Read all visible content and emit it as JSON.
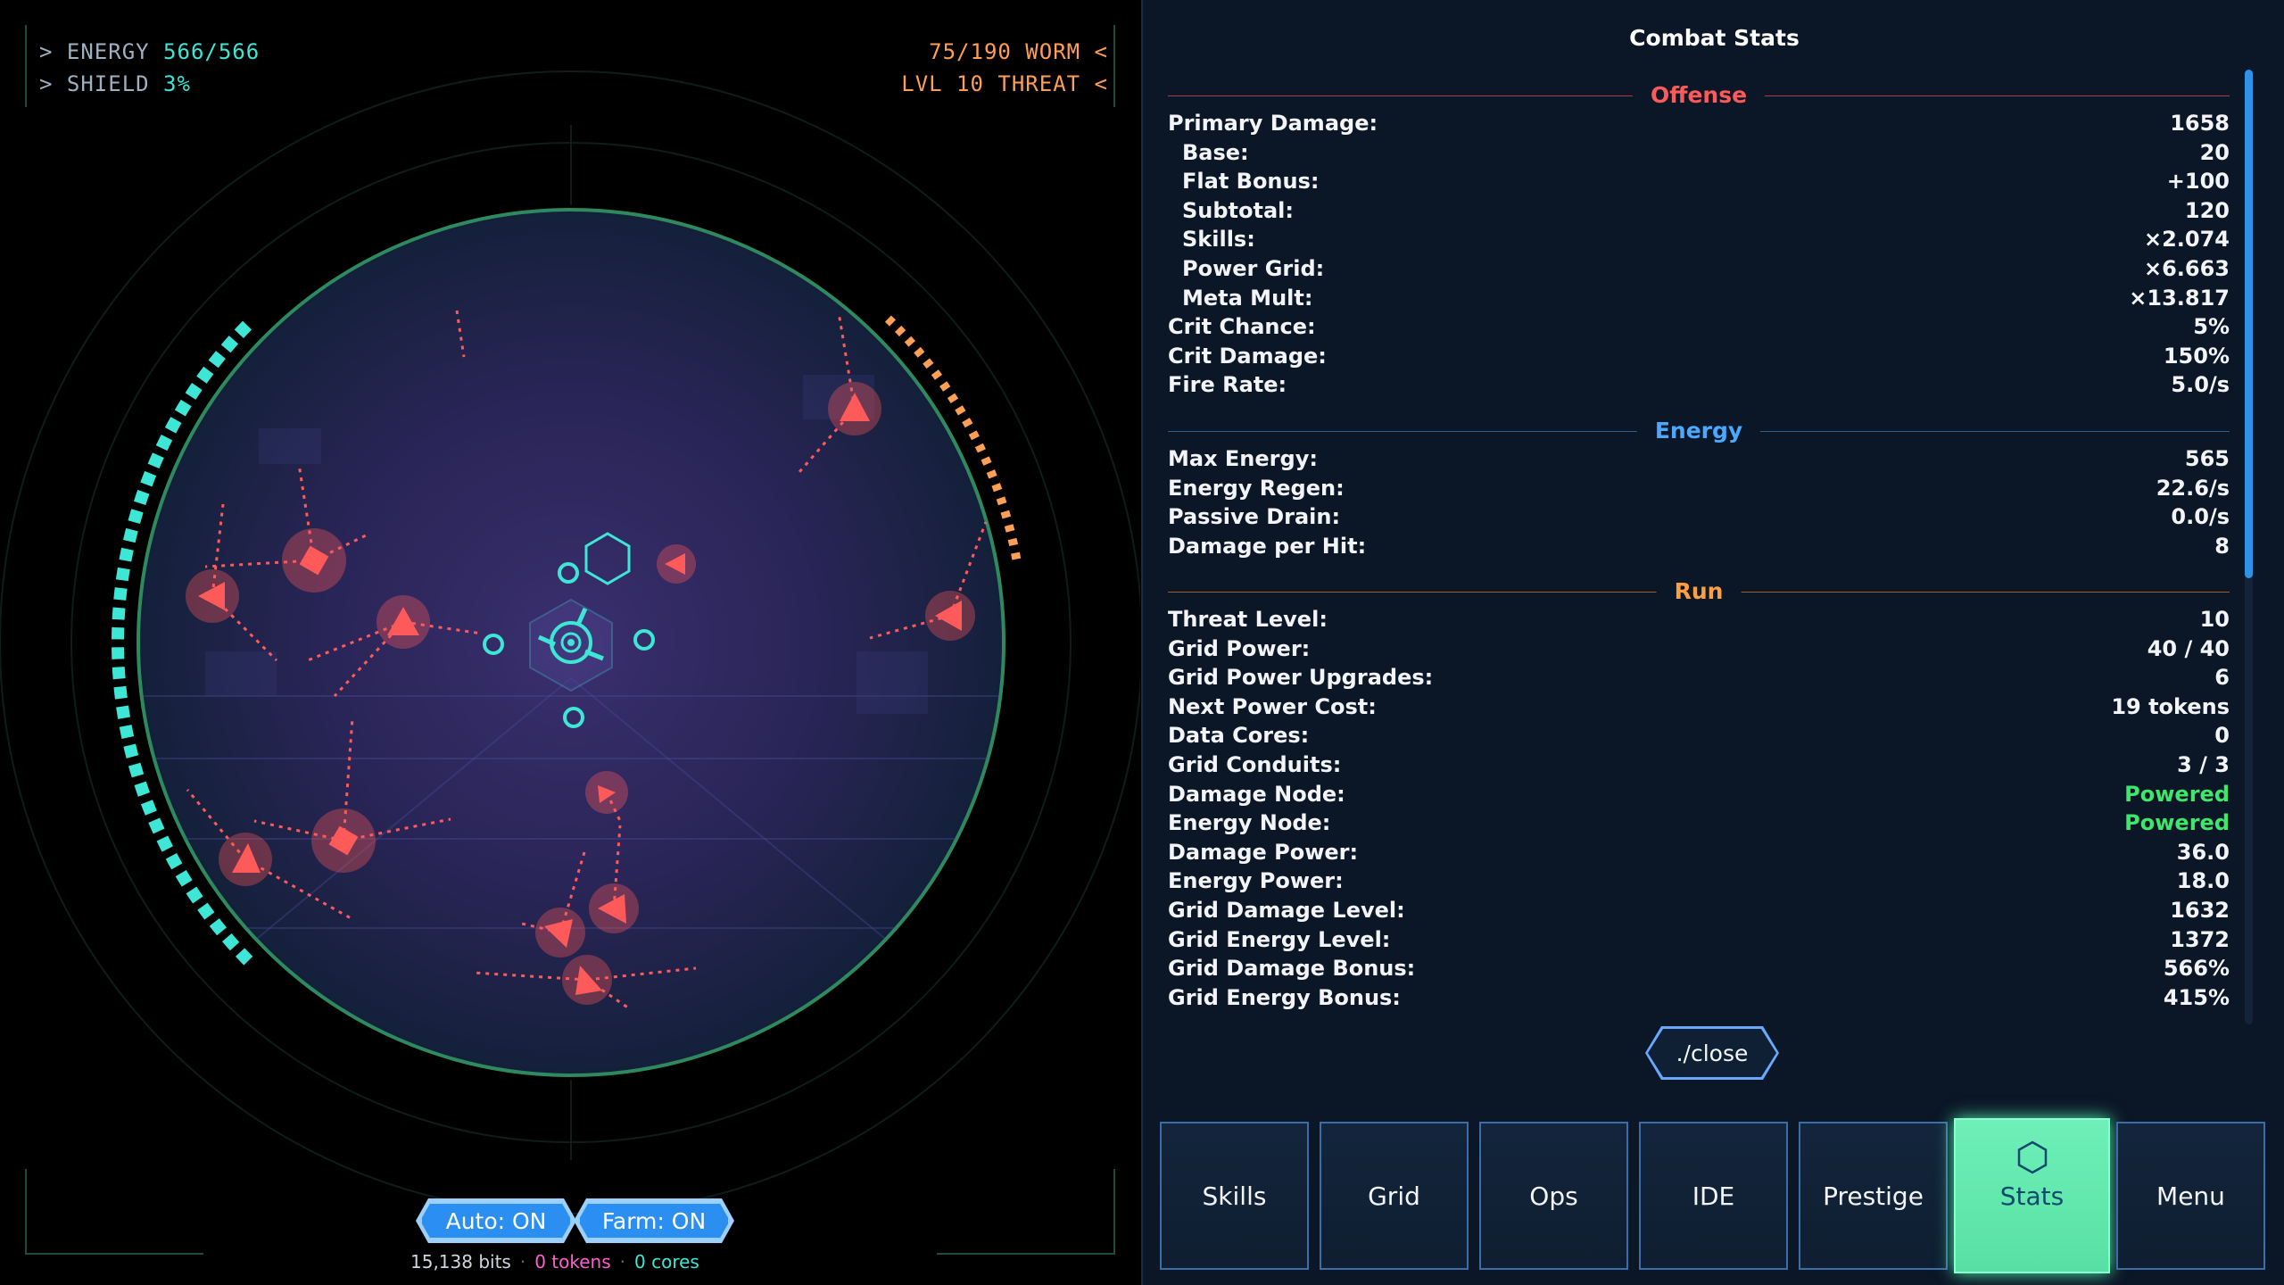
{
  "hud": {
    "energy_label": "> ENERGY",
    "energy_value": "566/566",
    "shield_label": "> SHIELD",
    "shield_value": "3%",
    "wave_value": "75/190",
    "wave_label": "WORM <",
    "level_value": "LVL 10",
    "level_label": "THREAT <"
  },
  "controls": {
    "auto_label": "Auto: ON",
    "farm_label": "Farm: ON"
  },
  "currency": {
    "bits": "15,138 bits",
    "tokens": "0 tokens",
    "cores": "0 cores",
    "separator": "·"
  },
  "panel": {
    "title": "Combat Stats",
    "sections": {
      "offense": "Offense",
      "energy": "Energy",
      "run": "Run"
    },
    "offense": [
      {
        "k": "Primary Damage:",
        "v": "1658",
        "sub": false
      },
      {
        "k": "Base:",
        "v": "20",
        "sub": true
      },
      {
        "k": "Flat Bonus:",
        "v": "+100",
        "sub": true
      },
      {
        "k": "Subtotal:",
        "v": "120",
        "sub": true
      },
      {
        "k": "Skills:",
        "v": "×2.074",
        "sub": true
      },
      {
        "k": "Power Grid:",
        "v": "×6.663",
        "sub": true
      },
      {
        "k": "Meta Mult:",
        "v": "×13.817",
        "sub": true
      },
      {
        "k": "Crit Chance:",
        "v": "5%",
        "sub": false
      },
      {
        "k": "Crit Damage:",
        "v": "150%",
        "sub": false
      },
      {
        "k": "Fire Rate:",
        "v": "5.0/s",
        "sub": false
      }
    ],
    "energy": [
      {
        "k": "Max Energy:",
        "v": "565"
      },
      {
        "k": "Energy Regen:",
        "v": "22.6/s"
      },
      {
        "k": "Passive Drain:",
        "v": "0.0/s"
      },
      {
        "k": "Damage per Hit:",
        "v": "8"
      }
    ],
    "run": [
      {
        "k": "Threat Level:",
        "v": "10"
      },
      {
        "k": "Grid Power:",
        "v": "40 / 40"
      },
      {
        "k": "Grid Power Upgrades:",
        "v": "6"
      },
      {
        "k": "Next Power Cost:",
        "v": "19 tokens"
      },
      {
        "k": "Data Cores:",
        "v": "0"
      },
      {
        "k": "Grid Conduits:",
        "v": "3 / 3"
      },
      {
        "k": "Damage Node:",
        "v": "Powered",
        "green": true
      },
      {
        "k": "Energy Node:",
        "v": "Powered",
        "green": true
      },
      {
        "k": "Damage Power:",
        "v": "36.0"
      },
      {
        "k": "Energy Power:",
        "v": "18.0"
      },
      {
        "k": "Grid Damage Level:",
        "v": "1632"
      },
      {
        "k": "Grid Energy Level:",
        "v": "1372"
      },
      {
        "k": "Grid Damage Bonus:",
        "v": "566%"
      },
      {
        "k": "Grid Energy Bonus:",
        "v": "415%"
      }
    ],
    "close_label": "./close"
  },
  "nav": [
    {
      "label": "Skills",
      "name": "nav-skills",
      "active": false
    },
    {
      "label": "Grid",
      "name": "nav-grid",
      "active": false
    },
    {
      "label": "Ops",
      "name": "nav-ops",
      "active": false
    },
    {
      "label": "IDE",
      "name": "nav-ide",
      "active": false
    },
    {
      "label": "Prestige",
      "name": "nav-prestige",
      "active": false
    },
    {
      "label": "Stats",
      "name": "nav-stats",
      "active": true,
      "icon": "hexagon-icon"
    },
    {
      "label": "Menu",
      "name": "nav-menu",
      "active": false
    }
  ],
  "colors": {
    "accent_cyan": "#3ee6d6",
    "accent_orange": "#ff9e55",
    "enemy_red": "#ff5a5a",
    "nav_active": "#5fe8a8",
    "arena_border": "#2e8a5e"
  },
  "status": {
    "energy_fraction": 1.0,
    "shield_fraction": 0.03,
    "wave_fraction": 0.395
  }
}
